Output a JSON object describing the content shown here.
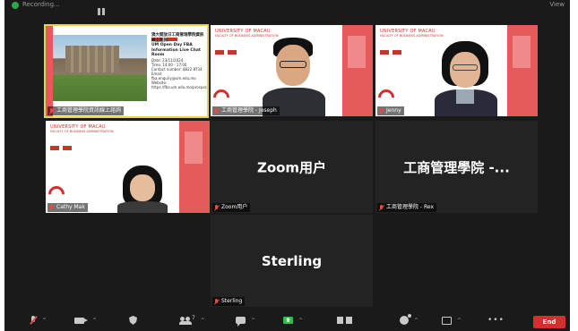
{
  "topbar": {
    "recording_label": "Recording...",
    "view_label": "View"
  },
  "tiles": [
    {
      "id": "poster",
      "name": "工商管理學院資訊線上諮詢",
      "type": "slide"
    },
    {
      "id": "joseph",
      "name": "工商管理學院 - Joseph",
      "type": "video"
    },
    {
      "id": "jenny",
      "name": "Jenny",
      "type": "video"
    },
    {
      "id": "cathy",
      "name": "Cathy Mak",
      "type": "video"
    },
    {
      "id": "zoom",
      "name": "Zoom用户",
      "display": "Zoom用户",
      "type": "name"
    },
    {
      "id": "rex",
      "name": "工商管理學院 - Rex",
      "display": "工商管理學院 -...",
      "type": "name"
    },
    {
      "id": "sterling",
      "name": "Sterling",
      "display": "Sterling",
      "type": "name"
    }
  ],
  "slide": {
    "university": "UNIVERSITY OF MACAU",
    "faculty": "FACULTY OF BUSINESS ADMINISTRATION"
  },
  "poster": {
    "title_zh": "澳大開放日工商管理學院資訊線上諮詢",
    "title_en": "UM Open Day FBA Information Live Chat Room",
    "date_line": "Date: 23/11/2024",
    "time_line": "Time: 14:00 - 17:00",
    "contact_line": "Contact number: 8822 8734",
    "email_line": "Email: fba.enquiry@um.edu.mo",
    "website_line": "Website: https://fba.um.edu.mo/prospective"
  },
  "toolbar": {
    "participants_count": "7",
    "end_label": "End"
  },
  "colors": {
    "brand_red": "#d32f2f",
    "share_green": "#2fbf4a",
    "background": "#1a1a1a"
  }
}
